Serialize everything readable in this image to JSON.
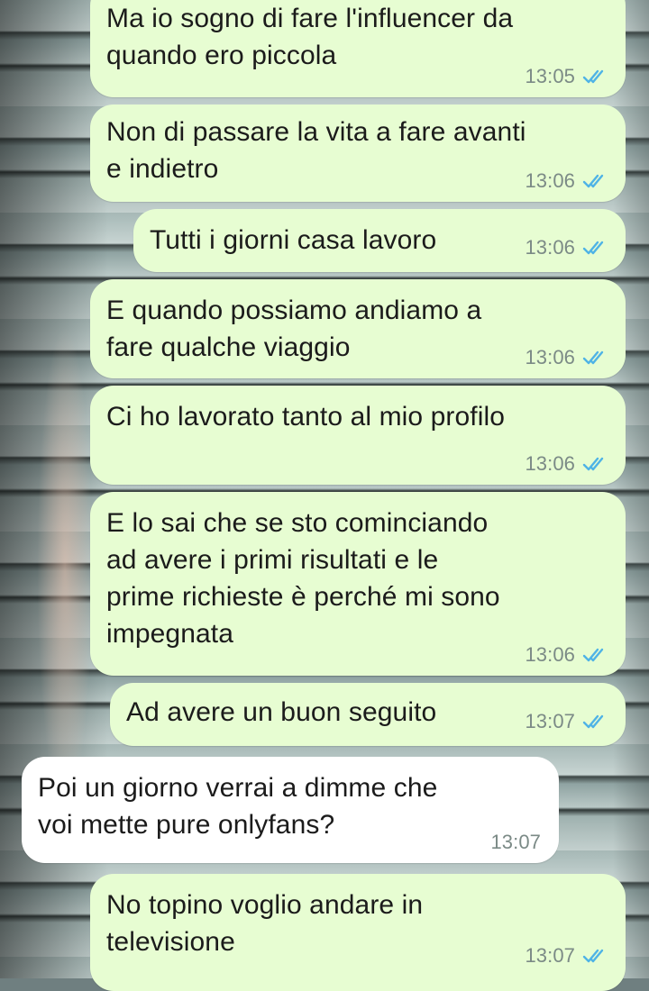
{
  "chat": {
    "messages": [
      {
        "direction": "out",
        "text": "Ma io sogno di fare l'influencer da\nquando ero piccola",
        "time": "13:05",
        "status": "read",
        "status_icon": "double-check-icon",
        "status_color": "#4fb3e6"
      },
      {
        "direction": "out",
        "text": "Non di passare la vita a fare avanti\ne indietro",
        "time": "13:06",
        "status": "read",
        "status_icon": "double-check-icon",
        "status_color": "#4fb3e6"
      },
      {
        "direction": "out",
        "text": "Tutti i giorni casa lavoro",
        "time": "13:06",
        "status": "read",
        "status_icon": "double-check-icon",
        "status_color": "#4fb3e6"
      },
      {
        "direction": "out",
        "text": "E quando possiamo andiamo a\nfare qualche viaggio",
        "time": "13:06",
        "status": "read",
        "status_icon": "double-check-icon",
        "status_color": "#4fb3e6"
      },
      {
        "direction": "out",
        "text": "Ci ho lavorato tanto al mio profilo",
        "time": "13:06",
        "status": "read",
        "status_icon": "double-check-icon",
        "status_color": "#4fb3e6"
      },
      {
        "direction": "out",
        "text": "E lo sai che se sto cominciando\nad avere i primi risultati e le\nprime richieste è perché mi sono\nimpegnata",
        "time": "13:06",
        "status": "read",
        "status_icon": "double-check-icon",
        "status_color": "#4fb3e6"
      },
      {
        "direction": "out",
        "text": "Ad avere un buon seguito",
        "time": "13:07",
        "status": "read",
        "status_icon": "double-check-icon",
        "status_color": "#4fb3e6"
      },
      {
        "direction": "in",
        "text": "Poi un giorno verrai a dimme che\nvoi mette pure onlyfans?",
        "time": "13:07"
      },
      {
        "direction": "out",
        "text": "No topino voglio andare in\ntelevisione",
        "time": "13:07",
        "status": "read",
        "status_icon": "double-check-icon",
        "status_color": "#4fb3e6"
      }
    ]
  },
  "colors": {
    "outgoing_bubble": "#e7fdd2",
    "incoming_bubble": "#ffffff",
    "text": "#1b1b1b",
    "meta_text": "#7b8a86",
    "read_ticks": "#4fb3e6"
  }
}
